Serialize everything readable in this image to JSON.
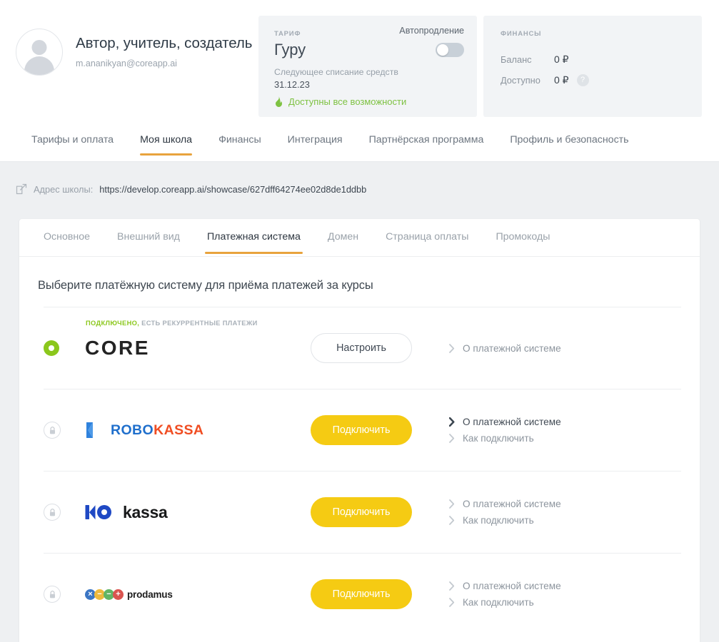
{
  "profile": {
    "name": "Автор, учитель, создатель",
    "email": "m.ananikyan@coreapp.ai",
    "avatar_icon": "user-avatar-placeholder-icon"
  },
  "tariff_card": {
    "eyebrow": "ТАРИФ",
    "plan_name": "Гуру",
    "next_charge_label": "Следующее списание средств",
    "next_charge_date": "31.12.23",
    "feature_text": "Доступны все возможности",
    "feature_icon": "flame-icon",
    "feature_color": "#7ec242",
    "autorenew_label": "Автопродление",
    "autorenew_on": false
  },
  "finance_card": {
    "eyebrow": "ФИНАНСЫ",
    "rows": [
      {
        "label": "Баланс",
        "value": "0 ₽",
        "has_help": false
      },
      {
        "label": "Доступно",
        "value": "0 ₽",
        "has_help": true
      }
    ],
    "help_glyph": "?"
  },
  "main_tabs": {
    "active_index": 1,
    "accent_color": "#e8a33d",
    "items": [
      {
        "label": "Тарифы и оплата"
      },
      {
        "label": "Моя школа"
      },
      {
        "label": "Финансы"
      },
      {
        "label": "Интеграция"
      },
      {
        "label": "Партнёрская программа"
      },
      {
        "label": "Профиль и безопасность"
      }
    ]
  },
  "school_url": {
    "icon": "external-link-icon",
    "label": "Адрес школы:",
    "value": "https://develop.coreapp.ai/showcase/627dff64274ee02d8de1ddbb"
  },
  "sub_tabs": {
    "active_index": 2,
    "items": [
      {
        "label": "Основное"
      },
      {
        "label": "Внешний вид"
      },
      {
        "label": "Платежная система"
      },
      {
        "label": "Домен"
      },
      {
        "label": "Страница оплаты"
      },
      {
        "label": "Промокоды"
      }
    ]
  },
  "panel": {
    "title": "Выберите платёжную систему для приёма платежей за курсы"
  },
  "payment_systems": [
    {
      "id": "core",
      "status_icon": "radio-selected-icon",
      "status_color": "#8bc71c",
      "badge_primary": "ПОДКЛЮЧЕНО,",
      "badge_secondary": "ЕСТЬ РЕКУРРЕНТНЫЕ ПЛАТЕЖИ",
      "logo_text": "CORE",
      "action_label": "Настроить",
      "action_style": "outline",
      "links": [
        {
          "label": "О платежной системе",
          "highlighted": false
        }
      ]
    },
    {
      "id": "robokassa",
      "status_icon": "lock-icon",
      "badge_primary": "",
      "badge_secondary": "",
      "logo_text_primary": "ROBO",
      "logo_text_secondary": "KASSA",
      "action_label": "Подключить",
      "action_style": "yellow",
      "links": [
        {
          "label": "О платежной системе",
          "highlighted": true
        },
        {
          "label": "Как подключить",
          "highlighted": false
        }
      ]
    },
    {
      "id": "yookassa",
      "status_icon": "lock-icon",
      "badge_primary": "",
      "badge_secondary": "",
      "logo_text": "kassa",
      "action_label": "Подключить",
      "action_style": "yellow",
      "links": [
        {
          "label": "О платежной системе",
          "highlighted": false
        },
        {
          "label": "Как подключить",
          "highlighted": false
        }
      ]
    },
    {
      "id": "prodamus",
      "status_icon": "lock-icon",
      "badge_primary": "",
      "badge_secondary": "",
      "logo_text": "prodamus",
      "dot_colors": [
        "#3b76c4",
        "#edb93c",
        "#62b565",
        "#d9544f"
      ],
      "dot_glyphs": [
        "×",
        "−",
        "−",
        "+"
      ],
      "action_label": "Подключить",
      "action_style": "yellow",
      "links": [
        {
          "label": "О платежной системе",
          "highlighted": false
        },
        {
          "label": "Как подключить",
          "highlighted": false
        }
      ]
    }
  ]
}
